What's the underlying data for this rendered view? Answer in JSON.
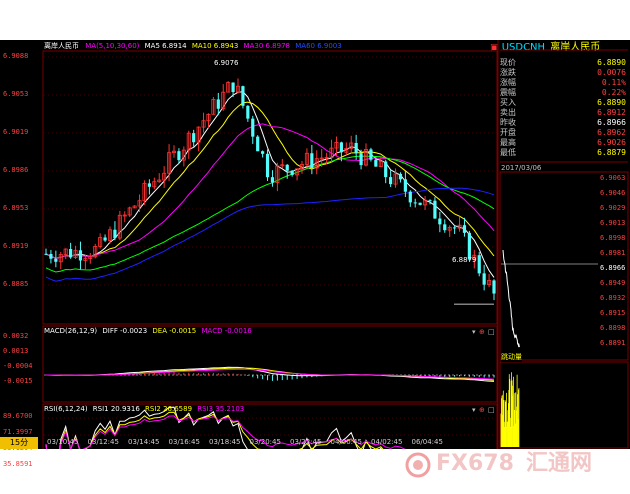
{
  "main_chart": {
    "title": "离岸人民币",
    "ma_label": "MA(5,10,30,60)",
    "ma5": "MA5 6.8914",
    "ma10": "MA10 6.8943",
    "ma30": "MA30 6.8978",
    "ma60": "MA60 6.9003",
    "y_ticks": [
      "6.9088",
      "6.9053",
      "6.9019",
      "6.8986",
      "6.8953",
      "6.8919",
      "6.8885"
    ],
    "high_marker": "6.9076",
    "low_marker": "6.8879"
  },
  "macd": {
    "title": "MACD(26,12,9)",
    "diff": "DIFF -0.0023",
    "dea": "DEA -0.0015",
    "macd": "MACD -0.0016",
    "y_ticks": [
      "0.0032",
      "0.0013",
      "-0.0004",
      "-0.0015"
    ]
  },
  "rsi": {
    "title": "RSI(6,12,24)",
    "rsi1": "RSI1 20.9316",
    "rsi2": "RSI2 26.6589",
    "rsi3": "RSI3 35.2103",
    "y_ticks": [
      "89.6700",
      "71.3997",
      "53.1294",
      "35.8591"
    ]
  },
  "time_axis": {
    "period": "15分",
    "ticks": [
      "03/10:45",
      "03/12:45",
      "03/14:45",
      "03/16:45",
      "03/18:45",
      "03/20:45",
      "03/22:45",
      "04/00:45",
      "04/02:45",
      "06/04:45"
    ]
  },
  "quote_panel": {
    "symbol": "USDCNH",
    "name": "离岸人民币",
    "rows": [
      {
        "label": "现价",
        "value": "6.8890",
        "color": "#ffff00"
      },
      {
        "label": "涨跌",
        "value": "0.0076",
        "color": "#ff4040"
      },
      {
        "label": "涨幅",
        "value": "0.11%",
        "color": "#ff4040"
      },
      {
        "label": "震幅",
        "value": "0.22%",
        "color": "#ff4040"
      },
      {
        "label": "买入",
        "value": "6.8890",
        "color": "#ffff00"
      },
      {
        "label": "卖出",
        "value": "6.8912",
        "color": "#ff4040"
      },
      {
        "label": "昨收",
        "value": "6.8966",
        "color": "#ffffff"
      },
      {
        "label": "开盘",
        "value": "6.8962",
        "color": "#ff4040"
      },
      {
        "label": "最高",
        "value": "6.9026",
        "color": "#ff4040"
      },
      {
        "label": "最低",
        "value": "6.8879",
        "color": "#ffff00"
      }
    ],
    "intraday_date": "2017/03/06",
    "intraday_ticks": [
      "6.9063",
      "6.9046",
      "6.9029",
      "6.9013",
      "6.8998",
      "6.8981",
      "6.8966",
      "6.8949",
      "6.8932",
      "6.8915",
      "6.8898",
      "6.8891"
    ],
    "volume_label": "跳动量"
  },
  "watermark": {
    "brand": "FX678",
    "name": "汇通网"
  },
  "colors": {
    "up": "#ff3232",
    "down": "#54fcfc",
    "ma5": "#ffffff",
    "ma10": "#ffff00",
    "ma30": "#ff00ff",
    "ma60": "#00ff00",
    "ma120": "#2020ff"
  }
}
